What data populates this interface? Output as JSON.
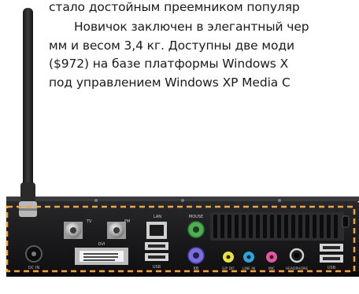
{
  "article": {
    "lines": [
      "стало достойным преемником популяр",
      "Новичок заключен в элегантный чер",
      "мм и весом 3,4 кг. Доступны две моди",
      "($972) на базе платформы Windows X",
      "под управлением Windows XP Media C"
    ]
  },
  "photo": {
    "port_labels": {
      "dc_in": "DC IN",
      "tv": "TV",
      "fm": "FM",
      "dvi": "DVI",
      "lan": "LAN",
      "mouse": "MOUSE",
      "kb": "KB",
      "spdif": "S/P DIF",
      "line_in": "LINE IN",
      "mic": "MIC",
      "headphone": "HEADPHONE",
      "usb": "USB"
    },
    "colors": {
      "chassis": "#1c1c1e",
      "frame": "#f2a33a",
      "mouse_port": "#4caf50",
      "kb_port": "#7a6fd8",
      "line_in": "#e8e14a",
      "headphone": "#2ea5d8",
      "mic": "#e05aa0"
    }
  }
}
